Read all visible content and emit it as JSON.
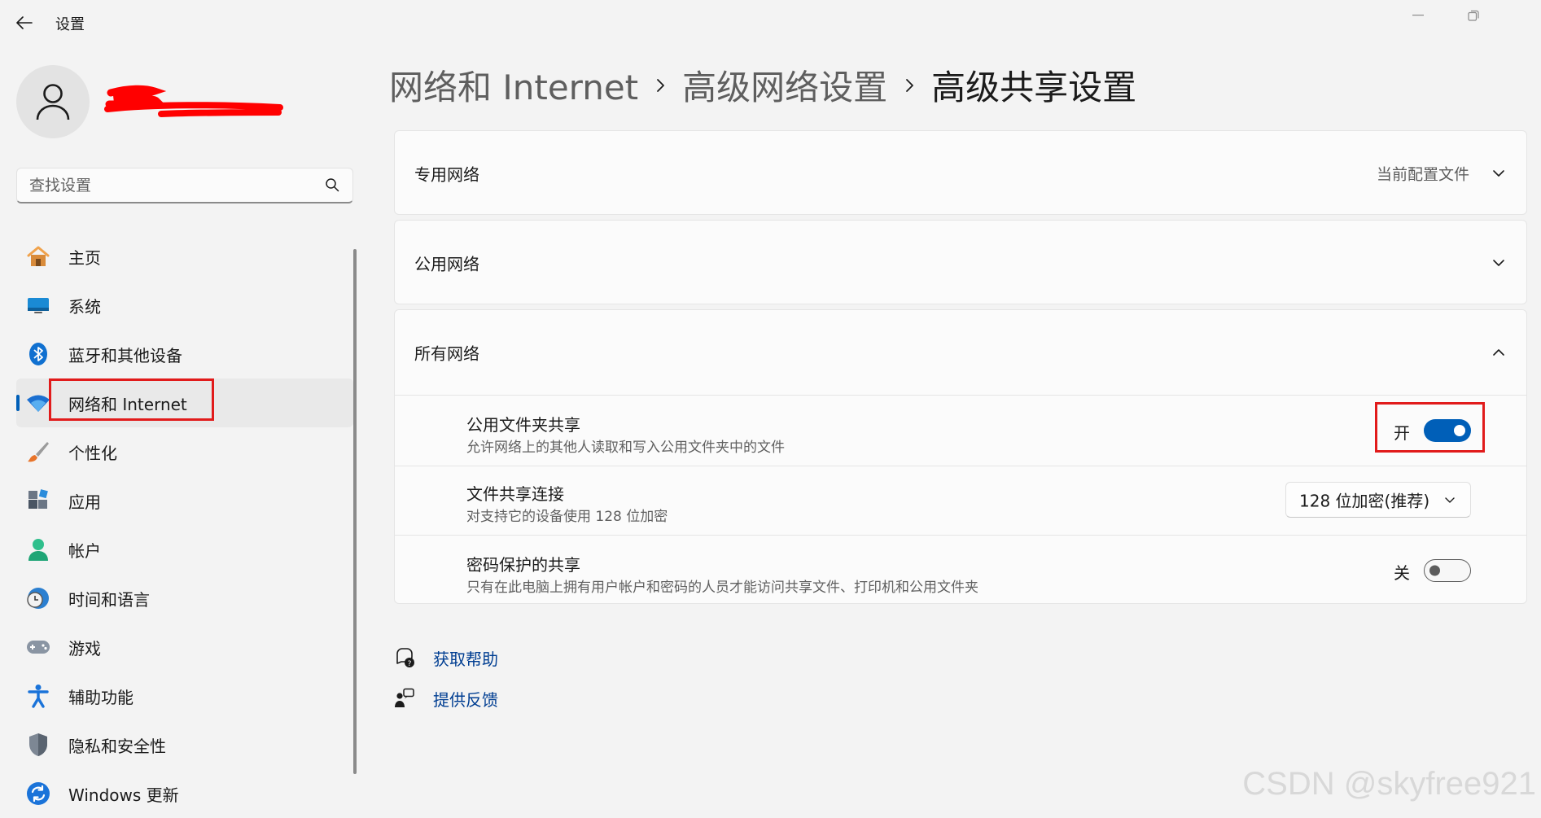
{
  "window": {
    "title": "设置",
    "back_icon": "arrow-left-icon",
    "controls": [
      "minimize-icon",
      "restore-icon"
    ]
  },
  "profile": {
    "avatar_icon": "user-icon",
    "name_redacted_color": "#ff0000"
  },
  "search": {
    "placeholder": "查找设置",
    "value": "",
    "icon": "search-icon"
  },
  "nav": {
    "items": [
      {
        "label": "主页",
        "icon": "home-icon",
        "active": false
      },
      {
        "label": "系统",
        "icon": "monitor-icon",
        "active": false
      },
      {
        "label": "蓝牙和其他设备",
        "icon": "bluetooth-icon",
        "active": false
      },
      {
        "label": "网络和 Internet",
        "icon": "wifi-icon",
        "active": true
      },
      {
        "label": "个性化",
        "icon": "brush-icon",
        "active": false
      },
      {
        "label": "应用",
        "icon": "apps-icon",
        "active": false
      },
      {
        "label": "帐户",
        "icon": "account-icon",
        "active": false
      },
      {
        "label": "时间和语言",
        "icon": "clock-globe-icon",
        "active": false
      },
      {
        "label": "游戏",
        "icon": "gamepad-icon",
        "active": false
      },
      {
        "label": "辅助功能",
        "icon": "accessibility-icon",
        "active": false
      },
      {
        "label": "隐私和安全性",
        "icon": "shield-icon",
        "active": false
      },
      {
        "label": "Windows 更新",
        "icon": "update-icon",
        "active": false
      }
    ]
  },
  "breadcrumb": {
    "items": [
      "网络和 Internet",
      "高级网络设置",
      "高级共享设置"
    ],
    "separator_icon": "chevron-right-icon"
  },
  "sections": {
    "private": {
      "title": "专用网络",
      "value": "当前配置文件",
      "expanded": false
    },
    "public": {
      "title": "公用网络",
      "expanded": false
    },
    "all": {
      "title": "所有网络",
      "expanded": true,
      "rows": {
        "public_folder": {
          "title": "公用文件夹共享",
          "desc": "允许网络上的其他人读取和写入公用文件夹中的文件",
          "state_label": "开",
          "on": true
        },
        "file_sharing": {
          "title": "文件共享连接",
          "desc": "对支持它的设备使用 128 位加密",
          "select_value": "128 位加密(推荐)"
        },
        "password": {
          "title": "密码保护的共享",
          "desc": "只有在此电脑上拥有用户帐户和密码的人员才能访问共享文件、打印机和公用文件夹",
          "state_label": "关",
          "on": false
        }
      }
    }
  },
  "links": {
    "help": {
      "label": "获取帮助",
      "icon": "help-chat-icon"
    },
    "feedback": {
      "label": "提供反馈",
      "icon": "feedback-icon"
    }
  },
  "colors": {
    "accent": "#005fb8",
    "link": "#003e92",
    "annotation": "#e11b1b"
  },
  "watermark": "CSDN @skyfree921"
}
